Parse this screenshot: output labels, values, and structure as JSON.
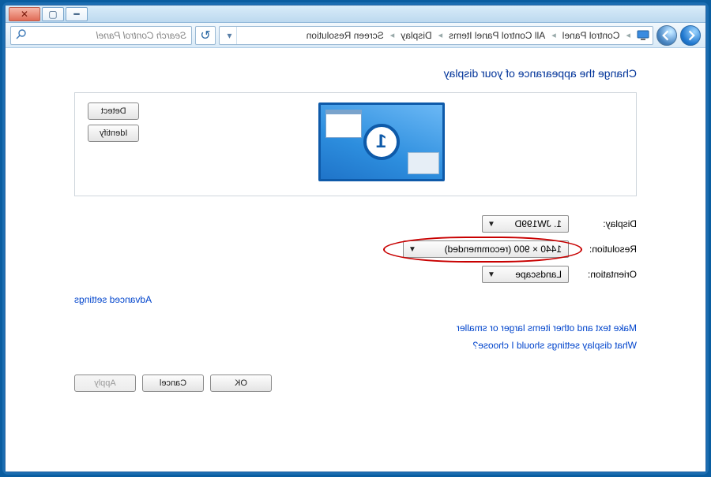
{
  "titlebar": {
    "close_tip": "Close",
    "max_tip": "Maximize",
    "min_tip": "Minimize"
  },
  "nav": {
    "breadcrumbs": [
      "Control Panel",
      "All Control Panel Items",
      "Screen Resolution"
    ],
    "breadcrumb_last": "Display",
    "search_placeholder": "Search Control Panel"
  },
  "page": {
    "title": "Change the appearance of your display",
    "detect_btn": "Detect",
    "identify_btn": "Identify",
    "monitor_label": "1",
    "labels": {
      "display": "Display:",
      "resolution": "Resolution:",
      "orientation": "Orientation:"
    },
    "values": {
      "display": "1. JW199D",
      "resolution": "1440 × 900 (recommended)",
      "orientation": "Landscape"
    },
    "advanced_link": "Advanced settings",
    "help1": "Make text and other items larger or smaller",
    "help2": "What display settings should I choose?",
    "ok_btn": "OK",
    "cancel_btn": "Cancel",
    "apply_btn": "Apply"
  }
}
